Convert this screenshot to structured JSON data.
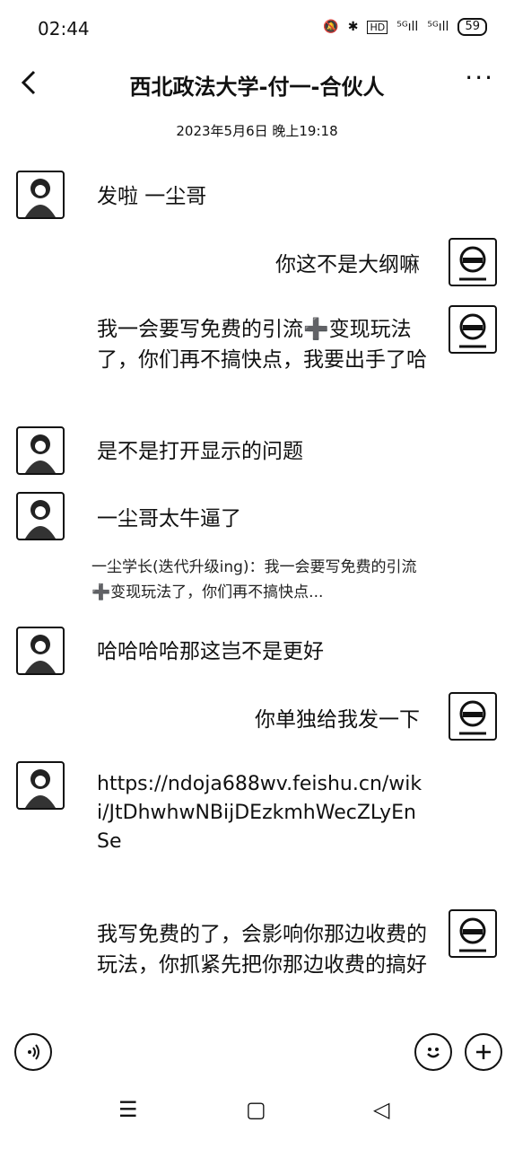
{
  "status": {
    "time": "02:44",
    "icons": [
      "mute-icon",
      "bluetooth-icon",
      "hd-icon",
      "signal-5g-icon",
      "signal-5g-icon"
    ],
    "battery": "59"
  },
  "header": {
    "title": "西北政法大学-付一-合伙人",
    "back_icon": "chevron-left-icon",
    "more_icon": "more-icon",
    "more": "···"
  },
  "date": "2023年5月6日 晚上19:18",
  "messages": [
    {
      "side": "left",
      "text": "发啦 一尘哥"
    },
    {
      "side": "right",
      "text": "你这不是大纲嘛"
    },
    {
      "side": "right",
      "text": "我一会要写免费的引流➕变现玩法了，你们再不搞快点，我要出手了哈"
    },
    {
      "side": "left",
      "text": "是不是打开显示的问题"
    },
    {
      "side": "left",
      "text": "一尘哥太牛逼了",
      "quote": "一尘学长(迭代升级ing)：我一会要写免费的引流➕变现玩法了，你们再不搞快点..."
    },
    {
      "side": "left",
      "text": "哈哈哈哈那这岂不是更好"
    },
    {
      "side": "right",
      "text": "你单独给我发一下"
    },
    {
      "side": "left",
      "text": "https://ndoja688wv.feishu.cn/wiki/JtDhwhwNBijDEzkmhWecZLyEnSe"
    },
    {
      "side": "right",
      "text": "我写免费的了，会影响你那边收费的玩法，你抓紧先把你那边收费的搞好"
    }
  ],
  "input": {
    "voice_icon": "voice-icon",
    "emoji_icon": "emoji-icon",
    "plus_icon": "plus-icon"
  },
  "sysnav": {
    "menu": "☰",
    "home": "▢",
    "back": "◁"
  }
}
